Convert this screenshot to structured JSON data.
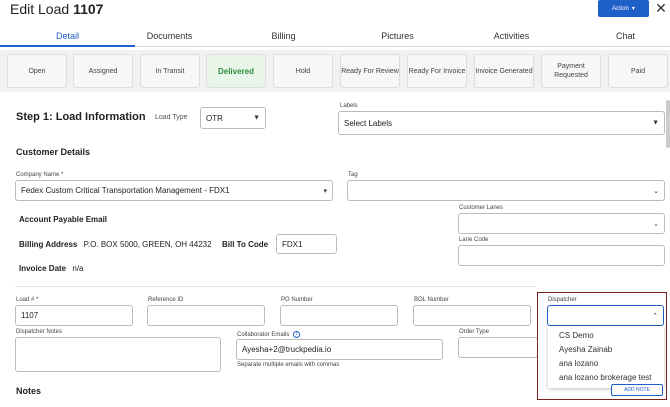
{
  "header": {
    "title_prefix": "Edit Load",
    "title_number": "1107",
    "action_label": "Action",
    "action_chevron": "chevron-down-icon",
    "close_icon": "close-icon",
    "accent": "#1f5fc8"
  },
  "tabs": [
    {
      "label": "Detail",
      "active": true
    },
    {
      "label": "Documents"
    },
    {
      "label": "Billing"
    },
    {
      "label": "Pictures"
    },
    {
      "label": "Activities"
    },
    {
      "label": "Chat"
    }
  ],
  "statuses": [
    {
      "label": "Open"
    },
    {
      "label": "Assigned"
    },
    {
      "label": "In Transit"
    },
    {
      "label": "Delivered",
      "active": true
    },
    {
      "label": "Hold"
    },
    {
      "label": "Ready For Review"
    },
    {
      "label": "Ready For Invoice"
    },
    {
      "label": "Invoice Generated"
    },
    {
      "label": "Payment Requested"
    },
    {
      "label": "Paid"
    }
  ],
  "step1": {
    "title": "Step 1: Load Information",
    "load_type_label": "Load Type",
    "load_type_value": "OTR",
    "labels_label": "Labels",
    "labels_placeholder": "Select Labels"
  },
  "customer": {
    "section_title": "Customer Details",
    "company_label": "Company Name *",
    "company_value": "Fedex Custom Critical Transportation Management - FDX1",
    "tag_label": "Tag",
    "ap_email_label": "Account Payable Email",
    "customer_lanes_label": "Customer Lanes",
    "billing_address_label": "Billing Address",
    "billing_address_value": "P.O. BOX 5000, GREEN, OH 44232",
    "bill_to_code_label": "Bill To Code",
    "bill_to_code_value": "FDX1",
    "lane_code_label": "Lane Code",
    "invoice_date_label": "Invoice Date",
    "invoice_date_value": "n/a"
  },
  "load": {
    "load_no_label": "Load # *",
    "load_no_value": "1107",
    "reference_label": "Reference ID",
    "po_label": "PO Number",
    "bol_label": "BOL Number",
    "dispatcher_label": "Dispatcher",
    "dispatcher_notes_label": "Dispatcher Notes",
    "collab_label": "Collaborator Emails",
    "collab_value": "Ayesha+2@truckpedia.io",
    "collab_hint": "Separate multiple emails with commas",
    "order_type_label": "Order Type"
  },
  "dispatcher_options": [
    "CS Demo",
    "Ayesha Zainab",
    "ana lozano",
    "ana lozano brokerage test"
  ],
  "notes": {
    "title": "Notes",
    "add_note_label": "ADD NOTE"
  }
}
